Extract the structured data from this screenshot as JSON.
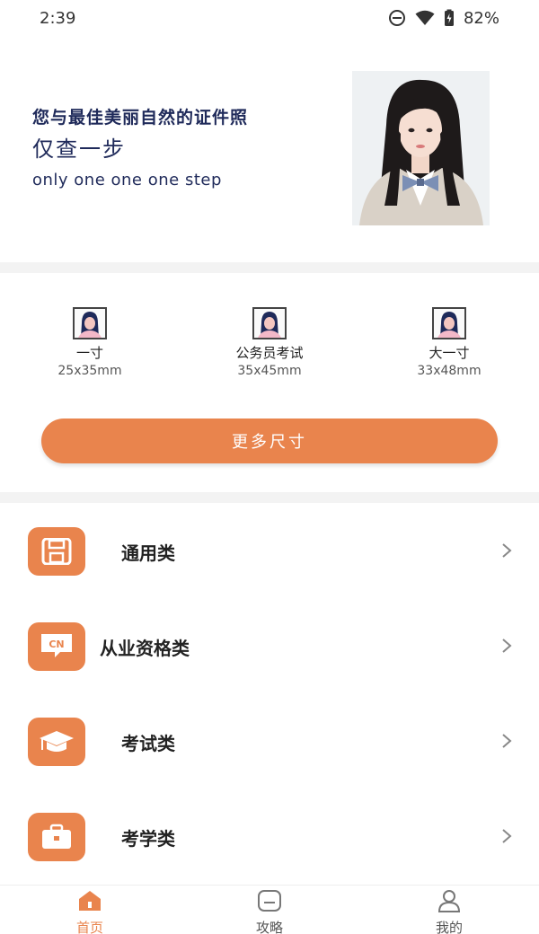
{
  "status": {
    "time": "2:39",
    "battery": "82%"
  },
  "hero": {
    "title": "您与最佳美丽自然的证件照",
    "subtitle": "仅查一步",
    "english": "only one one one step"
  },
  "sizes": [
    {
      "name": "一寸",
      "dim": "25x35mm"
    },
    {
      "name": "公务员考试",
      "dim": "35x45mm"
    },
    {
      "name": "大一寸",
      "dim": "33x48mm"
    }
  ],
  "more_button": "更多尺寸",
  "menu": [
    {
      "label": "通用类",
      "icon": "floppy-disk-icon"
    },
    {
      "label": "从业资格类",
      "icon": "cn-badge-icon",
      "badge": "CN"
    },
    {
      "label": "考试类",
      "icon": "graduation-cap-icon"
    },
    {
      "label": "考学类",
      "icon": "briefcase-icon"
    }
  ],
  "tabs": [
    {
      "label": "首页",
      "active": true
    },
    {
      "label": "攻略",
      "active": false
    },
    {
      "label": "我的",
      "active": false
    }
  ],
  "colors": {
    "accent": "#e9844d",
    "title_navy": "#1f2a5a"
  }
}
